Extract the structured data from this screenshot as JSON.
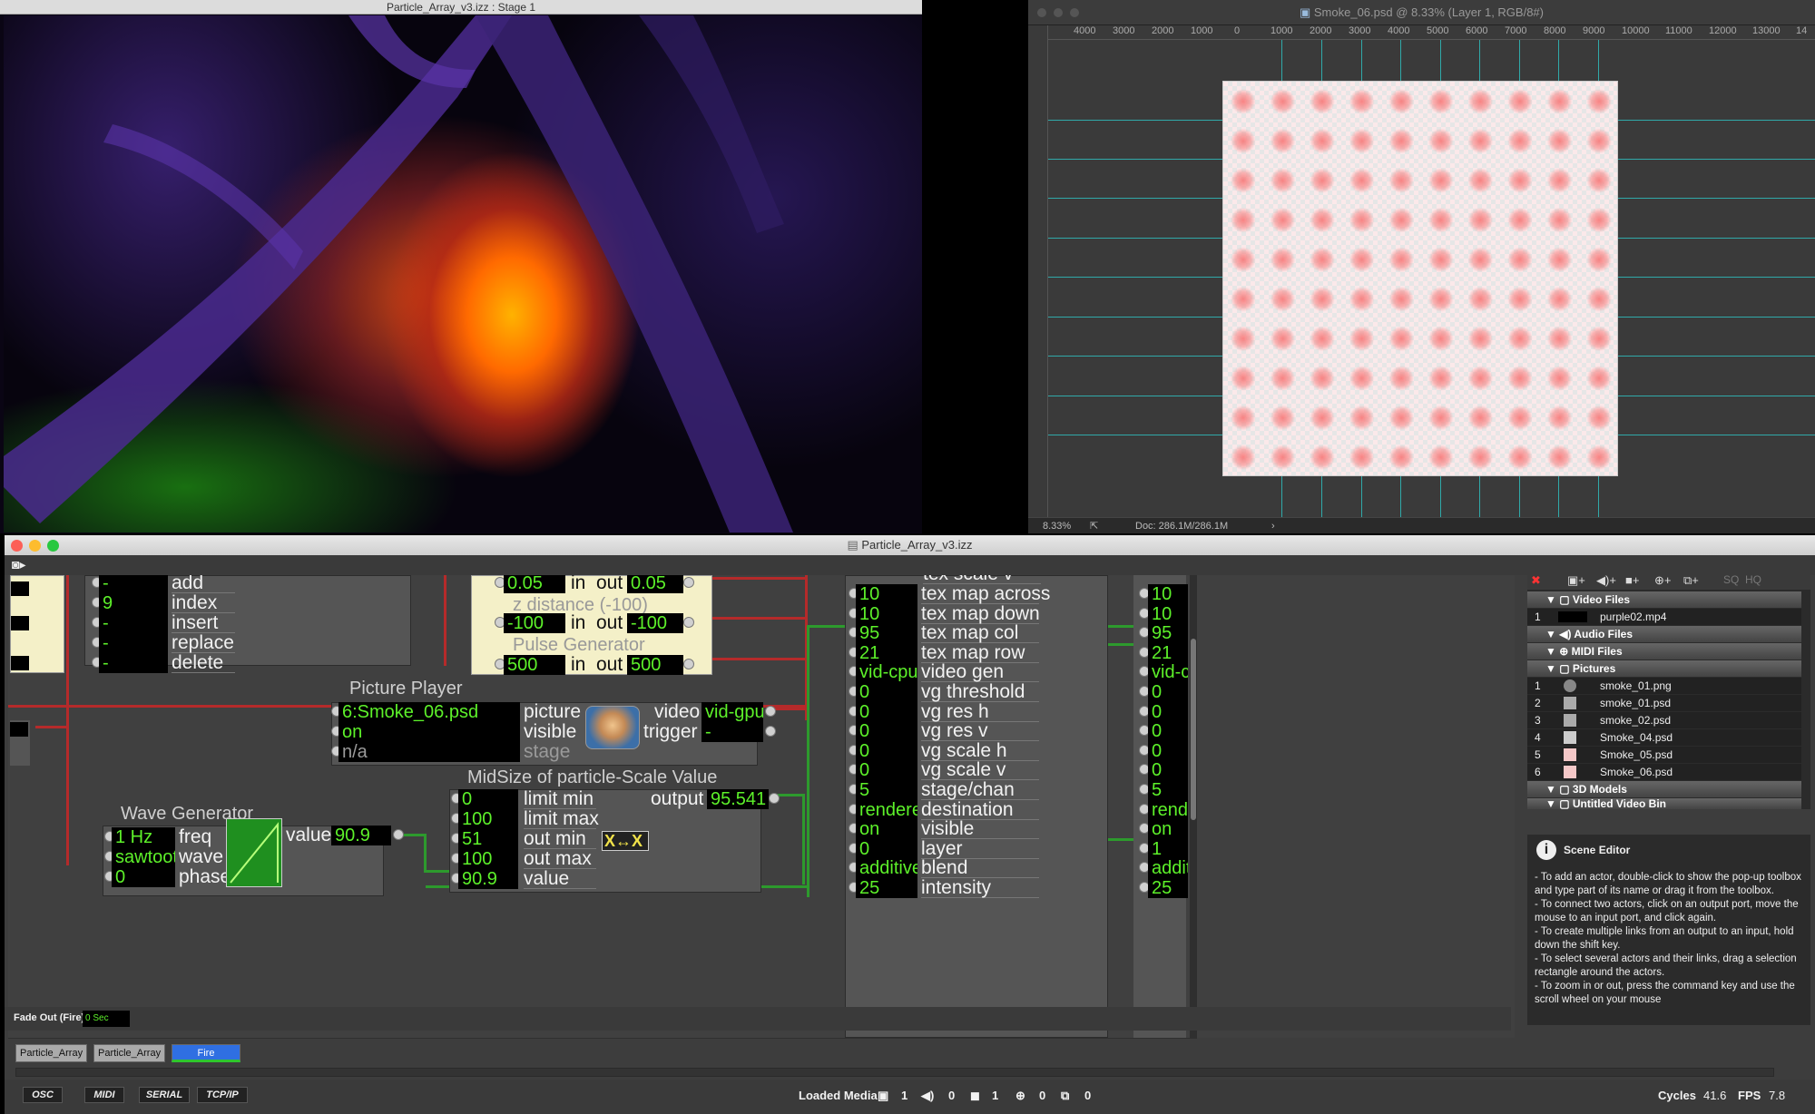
{
  "stage_window": {
    "title": "Particle_Array_v3.izz : Stage 1"
  },
  "photoshop": {
    "title": "Smoke_06.psd @ 8.33% (Layer 1, RGB/8#)",
    "ruler_labels": [
      "4000",
      "3000",
      "2000",
      "1000",
      "0",
      "1000",
      "2000",
      "3000",
      "4000",
      "5000",
      "6000",
      "7000",
      "8000",
      "9000",
      "10000",
      "11000",
      "12000",
      "13000",
      "14"
    ],
    "zoom": "8.33%",
    "doc": "Doc: 286.1M/286.1M"
  },
  "isadora": {
    "title": "Particle_Array_v3.izz",
    "colors": {
      "wire_red": "#b52a2a",
      "wire_green": "#2d9a2d",
      "value_green": "#5df12a"
    },
    "list_actor": {
      "rows": [
        {
          "value": "-",
          "label": "add"
        },
        {
          "value": "9",
          "label": "index"
        },
        {
          "value": "-",
          "label": "insert"
        },
        {
          "value": "-",
          "label": "replace"
        },
        {
          "value": "-",
          "label": "delete"
        }
      ]
    },
    "generator_actor": {
      "row1": {
        "in_val": "0.05",
        "in": "in",
        "out": "out",
        "out_val": "0.05"
      },
      "z_title": "z distance (-100)",
      "row2": {
        "in_val": "-100",
        "in": "in",
        "out": "out",
        "out_val": "-100"
      },
      "pulse_title": "Pulse Generator",
      "row3": {
        "in_val": "500",
        "in": "in",
        "out": "out",
        "out_val": "500"
      }
    },
    "picture_player": {
      "title": "Picture Player",
      "picture_val": "6:Smoke_06.psd",
      "picture_lbl": "picture",
      "visible_val": "on",
      "visible_lbl": "visible",
      "stage_val": "n/a",
      "stage_lbl": "stage",
      "video_lbl": "video",
      "video_val": "vid-gpu",
      "trigger_lbl": "trigger",
      "trigger_val": "-"
    },
    "midsize": {
      "title": "MidSize of particle-Scale Value",
      "rows": [
        {
          "value": "0",
          "label": "limit min"
        },
        {
          "value": "100",
          "label": "limit max"
        },
        {
          "value": "51",
          "label": "out min"
        },
        {
          "value": "100",
          "label": "out max"
        },
        {
          "value": "90.9",
          "label": "value"
        }
      ],
      "output_lbl": "output",
      "output_val": "95.541"
    },
    "wave_generator": {
      "title": "Wave Generator",
      "rows": [
        {
          "value": "1 Hz",
          "label": "freq"
        },
        {
          "value": "sawtooth",
          "label": "wave"
        },
        {
          "value": "0",
          "label": "phase"
        }
      ],
      "value_lbl": "value",
      "value_val": "90.9"
    },
    "particles": {
      "partial_row": {
        "label": "tex scale v"
      },
      "rows": [
        {
          "value": "10",
          "label": "tex map across",
          "out": "10"
        },
        {
          "value": "10",
          "label": "tex map down",
          "out": "10"
        },
        {
          "value": "95",
          "label": "tex map col",
          "out": "95"
        },
        {
          "value": "21",
          "label": "tex map row",
          "out": "21"
        },
        {
          "value": "vid-cpu",
          "label": "video gen",
          "out": "vid-c"
        },
        {
          "value": "0",
          "label": "vg threshold",
          "out": "0"
        },
        {
          "value": "0",
          "label": "vg res h",
          "out": "0"
        },
        {
          "value": "0",
          "label": "vg res v",
          "out": "0"
        },
        {
          "value": "0",
          "label": "vg scale h",
          "out": "0"
        },
        {
          "value": "0",
          "label": "vg scale v",
          "out": "0"
        },
        {
          "value": "5",
          "label": "stage/chan",
          "out": "5"
        },
        {
          "value": "renderer",
          "label": "destination",
          "out": "rend"
        },
        {
          "value": "on",
          "label": "visible",
          "out": "on"
        },
        {
          "value": "0",
          "label": "layer",
          "out": "1"
        },
        {
          "value": "additive",
          "label": "blend",
          "out": "addit"
        },
        {
          "value": "25",
          "label": "intensity",
          "out": "25"
        }
      ]
    },
    "media_bin": {
      "sections": [
        {
          "label": "Video Files"
        },
        {
          "label": "Audio Files"
        },
        {
          "label": "MIDI Files"
        },
        {
          "label": "Pictures"
        },
        {
          "label": "3D Models"
        },
        {
          "label": "Untitled Video Bin"
        }
      ],
      "video_items": [
        {
          "num": "1",
          "name": "purple02.mp4"
        }
      ],
      "picture_items": [
        {
          "num": "1",
          "name": "smoke_01.png"
        },
        {
          "num": "2",
          "name": "smoke_01.psd"
        },
        {
          "num": "3",
          "name": "smoke_02.psd"
        },
        {
          "num": "4",
          "name": "Smoke_04.psd"
        },
        {
          "num": "5",
          "name": "Smoke_05.psd"
        },
        {
          "num": "6",
          "name": "Smoke_06.psd"
        }
      ]
    },
    "scene_editor": {
      "title": "Scene Editor",
      "lines": [
        "- To add an actor, double-click to show the pop-up toolbox and type part of its name or drag it from the toolbox.",
        "- To connect two actors, click on an output port, move the mouse to an input port, and click again.",
        "- To create multiple links from an output to an input, hold down the shift key.",
        "- To select several actors and their links, drag a selection rectangle around the actors.",
        "- To zoom in or out, press the command key and use the scroll wheel on your mouse"
      ]
    },
    "fade_out": {
      "label": "Fade Out (Fire):",
      "value": "0 Sec"
    },
    "scene_tabs": [
      "Particle_Array",
      "Particle_Array",
      "Fire"
    ],
    "protocols": [
      "OSC",
      "MIDI",
      "SERIAL",
      "TCP/IP"
    ],
    "status": {
      "loaded_media": "Loaded Media",
      "movie_count": "1",
      "audio_count": "0",
      "picture_count": "1",
      "model_count": "0",
      "bin_count": "0",
      "cycles_lbl": "Cycles",
      "cycles_val": "41.6",
      "fps_lbl": "FPS",
      "fps_val": "7.8"
    }
  }
}
